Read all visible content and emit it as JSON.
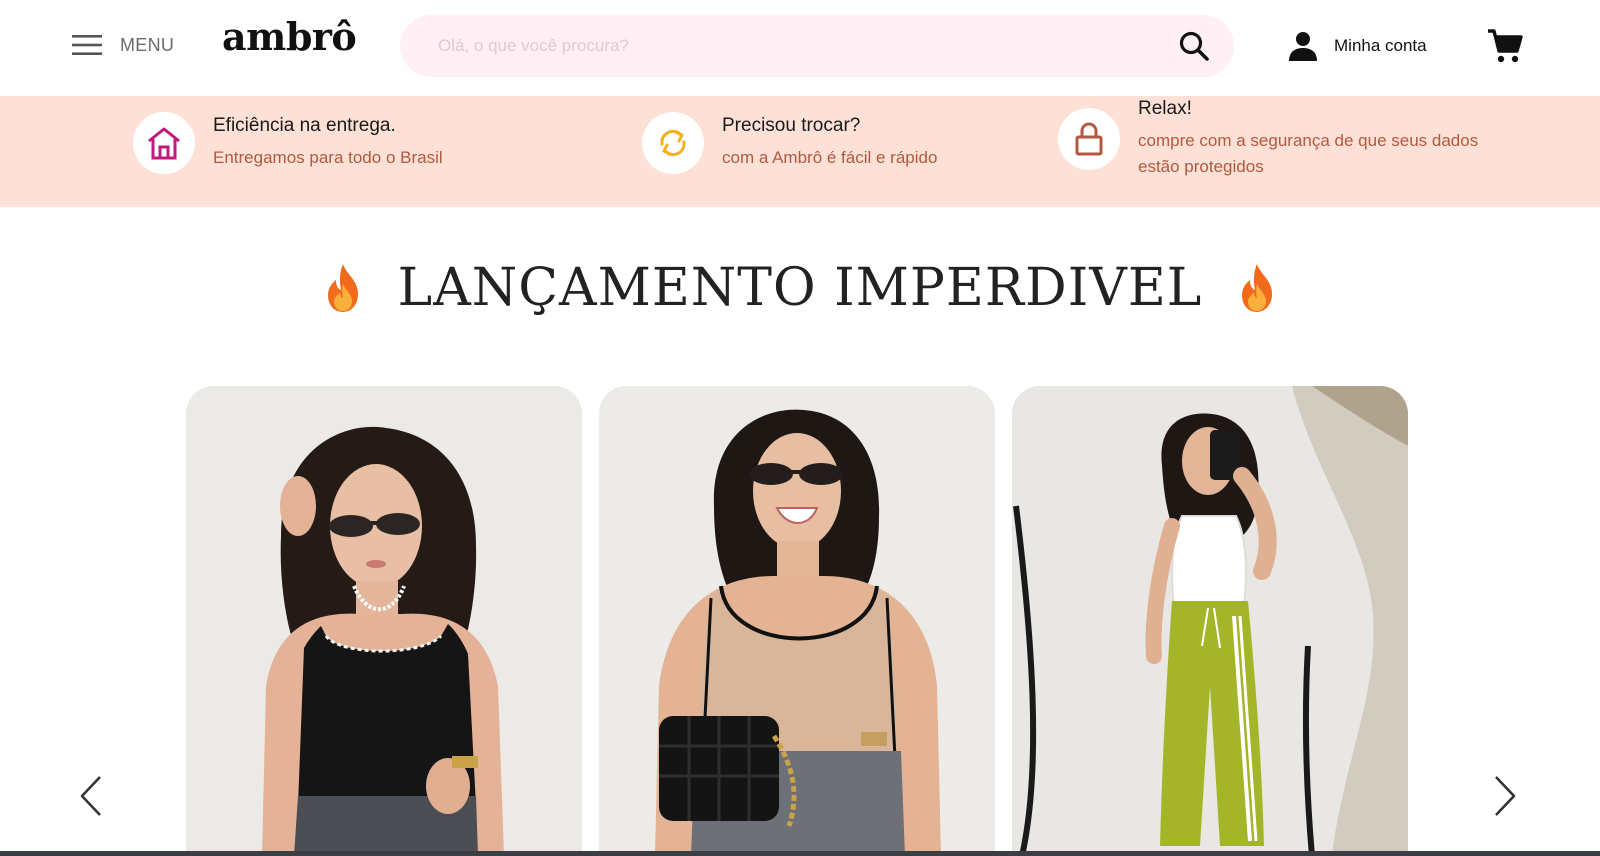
{
  "header": {
    "menu_label": "MENU",
    "logo_text": "ambrô",
    "search_placeholder": "Olá, o que você procura?",
    "account_label": "Minha conta",
    "icons": {
      "menu": "hamburger-icon",
      "search": "search-icon",
      "account": "user-icon",
      "cart": "cart-icon"
    }
  },
  "benefits": [
    {
      "icon": "house-icon",
      "icon_color": "#c2187a",
      "title": "Eficiência na entrega.",
      "description": "Entregamos para todo o Brasil"
    },
    {
      "icon": "exchange-icon",
      "icon_color": "#f2b01e",
      "title": "Precisou trocar?",
      "description": "com a Ambrô é fácil e rápido"
    },
    {
      "icon": "lock-icon",
      "icon_color": "#b3593f",
      "title": "Relax!",
      "description": "compre com a segurança de que seus dados estão protegidos"
    }
  ],
  "section": {
    "title": "LANÇAMENTO IMPERDIVEL",
    "decoration_icon": "fire-icon"
  },
  "carousel": {
    "products": [
      {
        "image": "model-black-tank-top-sunglasses"
      },
      {
        "image": "model-beige-tank-top-black-bag"
      },
      {
        "image": "model-white-tank-green-pants-mirror-selfie"
      }
    ],
    "prev_icon": "chevron-left-icon",
    "next_icon": "chevron-right-icon"
  },
  "colors": {
    "search_bg": "#fff0f5",
    "benefits_bg": "#fde0d6",
    "accent_text": "#b3593f",
    "brand_pink": "#c2187a",
    "exchange_yellow": "#f2b01e"
  }
}
